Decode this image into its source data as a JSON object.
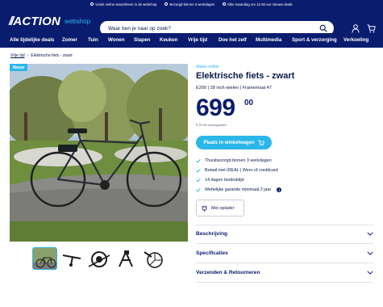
{
  "usp_bar": [
    {
      "icon": "check-circle-icon",
      "text": "Uniek online assortiment in de webshop"
    },
    {
      "icon": "truck-icon",
      "text": "Bezorgd binnen 3 werkdagen"
    },
    {
      "icon": "clock-icon",
      "text": "Elke maandag om 12.00 uur nieuwe deals"
    }
  ],
  "header": {
    "logo_slashes": "//",
    "logo_text": "ACTION",
    "logo_sub": "webshop",
    "search_placeholder": "Waar ben je naar op zoek?"
  },
  "nav": [
    "Alle tijdelijke deals",
    "Zomer",
    "Tuin",
    "Wonen",
    "Slapen",
    "Keuken",
    "Vrije tijd",
    "Doe het zelf",
    "Multimedia",
    "Sport & verzorging",
    "Verkoeling"
  ],
  "breadcrumb": {
    "root": "Vrije tijd",
    "separator": "›",
    "current": "Elektrische fiets - zwart"
  },
  "badge": "Nieuw",
  "product": {
    "availability": "Alleen online",
    "title": "Elektrische fiets - zwart",
    "subtitle": "E200 | 28 inch wielen | Framemaat 47",
    "price_main": "699",
    "price_cents": "00",
    "price_note": "€ 25,95 bezorgkosten",
    "add_to_cart": "Plaats in winkelwagen",
    "usps": [
      "Thuisbezorgd binnen 3 werkdagen",
      "Betaal met iDEAL | Wero of creditcard",
      "14 dagen bedenktijd",
      "Wettelijke garantie minimaal 2 jaar"
    ],
    "variant": "Met oplader"
  },
  "accordions": [
    "Beschrijving",
    "Specificaties",
    "Verzenden & Retourneren"
  ],
  "colors": {
    "navy": "#0a1c6e",
    "accent": "#2bb6e8"
  }
}
